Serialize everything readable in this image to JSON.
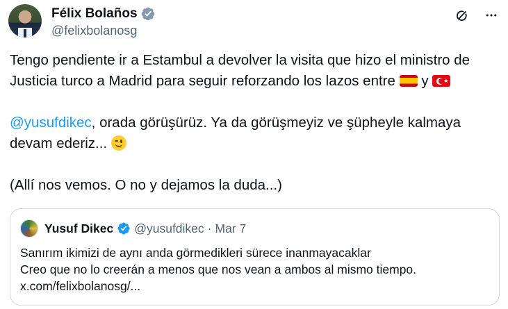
{
  "author": {
    "display_name": "Félix Bolaños",
    "handle": "@felixbolanosg",
    "verified": true
  },
  "icons": {
    "grok": "grok-icon",
    "more": "more-icon",
    "verified": "verified-badge-icon",
    "verified_color": "#829aab",
    "verified_blue": "#1d9bf0"
  },
  "tweet": {
    "line1": "Tengo pendiente ir a Estambul a devolver la visita que hizo el ministro de",
    "line2": "Justicia turco a Madrid para seguir reforzando los lazos entre",
    "line2_y": "y",
    "mention": "@yusufdikec",
    "line3_rest": ", orada görüşürüz. Ya da görüşmeyiz ve şüpheyle kalmaya",
    "line4": "devam ederiz...",
    "line5": "(Allí nos vemos. O no y dejamos la duda...)"
  },
  "quote": {
    "display_name": "Yusuf Dikec",
    "handle": "@yusufdikec",
    "separator": "·",
    "date": "Mar 7",
    "body_line1": "Sanırım ikimizi de aynı anda görmedikleri sürece inanmayacaklar",
    "body_line2": "Creo que no lo creerán a menos que nos vean a ambos al mismo tiempo.",
    "body_line3": "x.com/felixbolanosg/..."
  }
}
